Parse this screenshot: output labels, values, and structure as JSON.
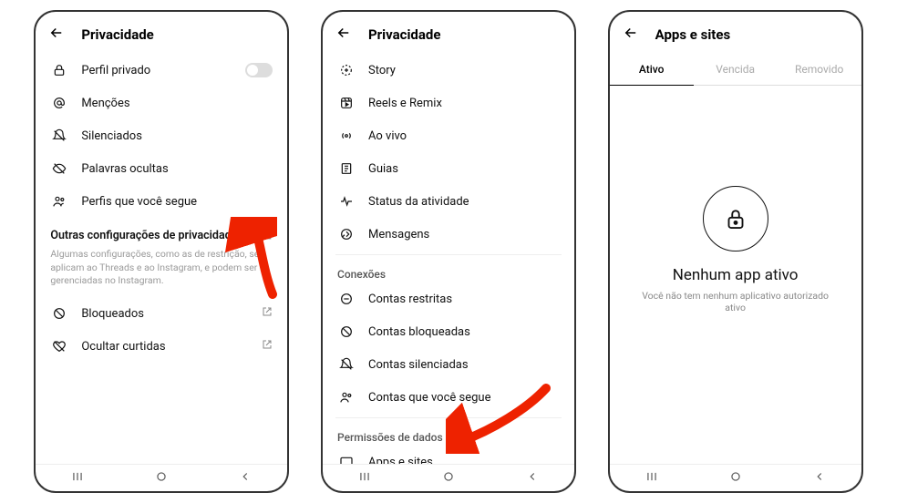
{
  "screen1": {
    "title": "Privacidade",
    "items": [
      {
        "icon": "lock",
        "label": "Perfil privado",
        "toggle": true
      },
      {
        "icon": "mention",
        "label": "Menções"
      },
      {
        "icon": "bell-off",
        "label": "Silenciados"
      },
      {
        "icon": "eye-off",
        "label": "Palavras ocultas"
      },
      {
        "icon": "people",
        "label": "Perfis que você segue"
      }
    ],
    "other_section": {
      "header": "Outras configurações de privacidade",
      "subtext": "Algumas configurações, como as de restrição, se aplicam ao Threads e ao Instagram, e podem ser gerenciadas no Instagram."
    },
    "other_items": [
      {
        "icon": "block",
        "label": "Bloqueados"
      },
      {
        "icon": "heart-off",
        "label": "Ocultar curtidas"
      }
    ]
  },
  "screen2": {
    "title": "Privacidade",
    "top_items": [
      {
        "icon": "story",
        "label": "Story"
      },
      {
        "icon": "reels",
        "label": "Reels e Remix"
      },
      {
        "icon": "live",
        "label": "Ao vivo"
      },
      {
        "icon": "guides",
        "label": "Guias"
      },
      {
        "icon": "activity",
        "label": "Status da atividade"
      },
      {
        "icon": "message",
        "label": "Mensagens"
      }
    ],
    "conns_header": "Conexões",
    "conns": [
      {
        "icon": "restrict",
        "label": "Contas restritas"
      },
      {
        "icon": "block",
        "label": "Contas bloqueadas"
      },
      {
        "icon": "mute",
        "label": "Contas silenciadas"
      },
      {
        "icon": "people",
        "label": "Contas que você segue"
      }
    ],
    "dataperm_header": "Permissões de dados",
    "dataperm": [
      {
        "icon": "apps",
        "label": "Apps e sites"
      }
    ]
  },
  "screen3": {
    "title": "Apps e sites",
    "tabs": [
      "Ativo",
      "Vencida",
      "Removido"
    ],
    "active_tab": 0,
    "empty_title": "Nenhum app ativo",
    "empty_sub": "Você não tem nenhum aplicativo autorizado ativo"
  },
  "nav": {
    "recent": "|||",
    "home": "○",
    "back": "<"
  }
}
